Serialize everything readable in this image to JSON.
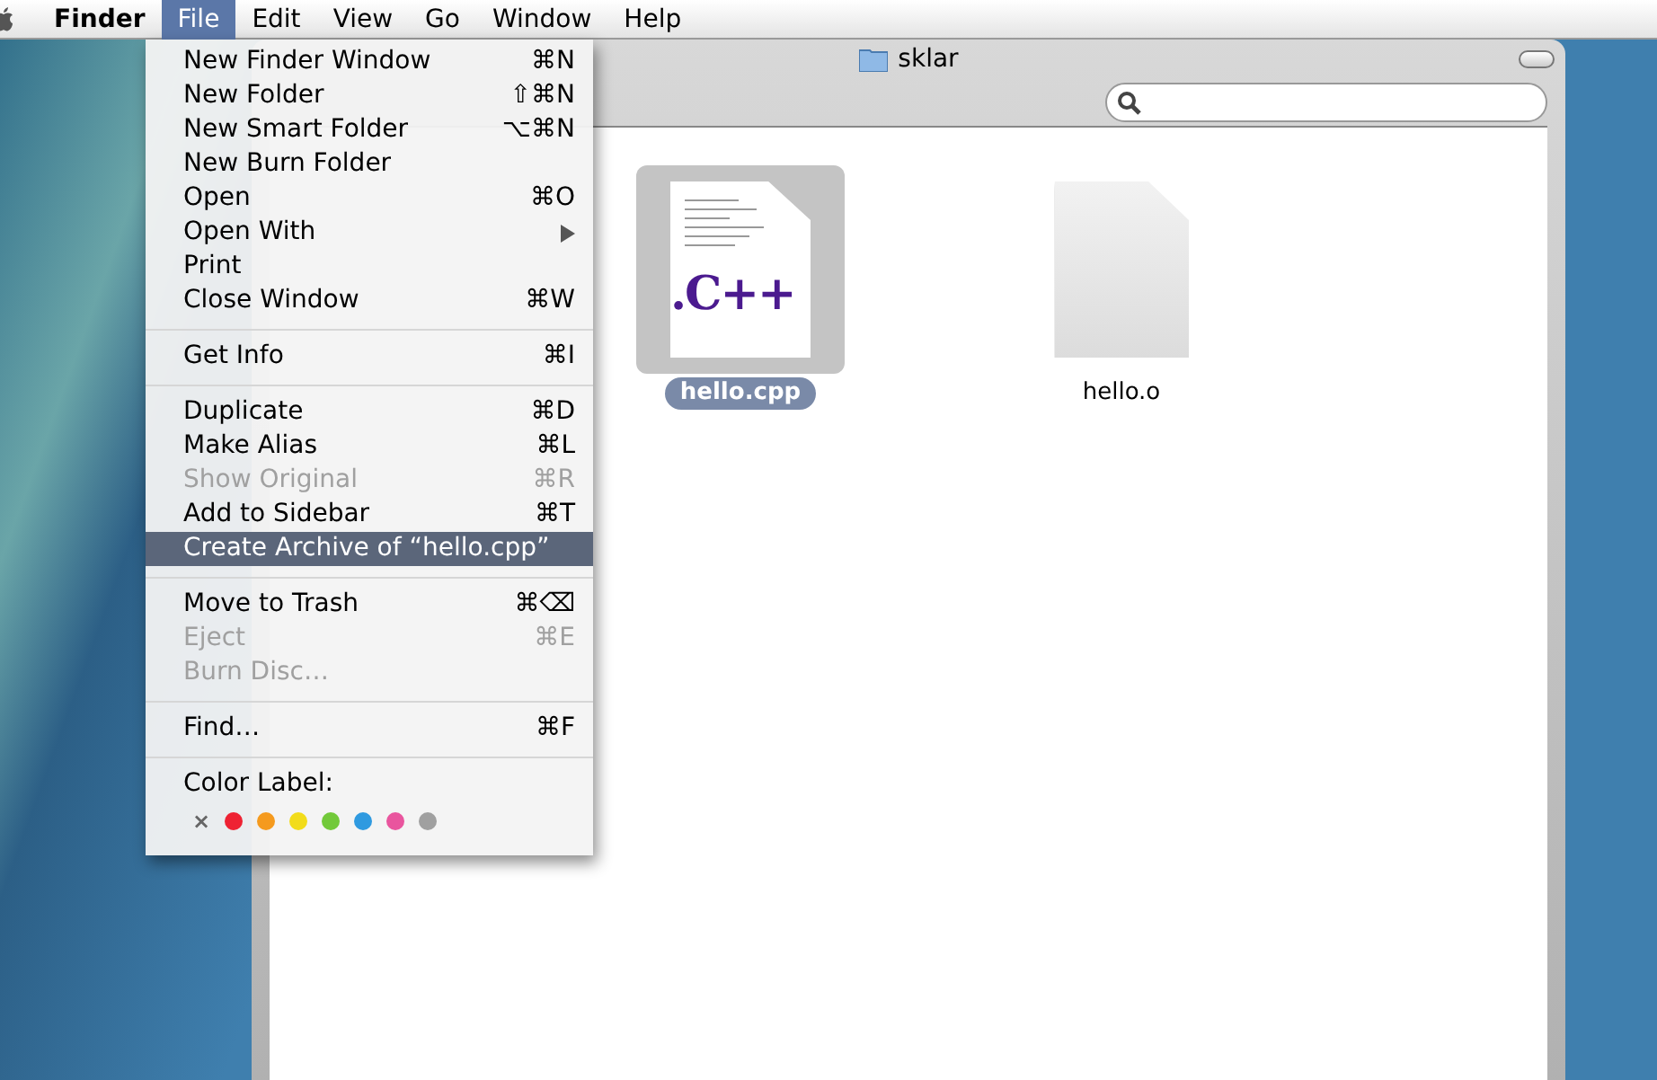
{
  "menu_bar": {
    "items": [
      {
        "label": "Finder",
        "selected": false,
        "bold": true
      },
      {
        "label": "File",
        "selected": true,
        "bold": false
      },
      {
        "label": "Edit",
        "selected": false,
        "bold": false
      },
      {
        "label": "View",
        "selected": false,
        "bold": false
      },
      {
        "label": "Go",
        "selected": false,
        "bold": false
      },
      {
        "label": "Window",
        "selected": false,
        "bold": false
      },
      {
        "label": "Help",
        "selected": false,
        "bold": false
      }
    ]
  },
  "window": {
    "title": "sklar"
  },
  "files": [
    {
      "name": "hello.cpp",
      "selected": true,
      "kind": "cpp",
      "icon_text": ".C++"
    },
    {
      "name": "hello.o",
      "selected": false,
      "kind": "blank"
    }
  ],
  "file_menu": {
    "groups": [
      [
        {
          "label": "New Finder Window",
          "shortcut": "⌘N",
          "disabled": false,
          "selected": false,
          "submenu": false
        },
        {
          "label": "New Folder",
          "shortcut": "⇧⌘N",
          "disabled": false,
          "selected": false,
          "submenu": false
        },
        {
          "label": "New Smart Folder",
          "shortcut": "⌥⌘N",
          "disabled": false,
          "selected": false,
          "submenu": false
        },
        {
          "label": "New Burn Folder",
          "disabled": false,
          "selected": false,
          "submenu": false
        },
        {
          "label": "Open",
          "shortcut": "⌘O",
          "disabled": false,
          "selected": false,
          "submenu": false
        },
        {
          "label": "Open With",
          "disabled": false,
          "selected": false,
          "submenu": true
        },
        {
          "label": "Print",
          "disabled": false,
          "selected": false,
          "submenu": false
        },
        {
          "label": "Close Window",
          "shortcut": "⌘W",
          "disabled": false,
          "selected": false,
          "submenu": false
        }
      ],
      [
        {
          "label": "Get Info",
          "shortcut": "⌘I",
          "disabled": false,
          "selected": false,
          "submenu": false
        }
      ],
      [
        {
          "label": "Duplicate",
          "shortcut": "⌘D",
          "disabled": false,
          "selected": false,
          "submenu": false
        },
        {
          "label": "Make Alias",
          "shortcut": "⌘L",
          "disabled": false,
          "selected": false,
          "submenu": false
        },
        {
          "label": "Show Original",
          "shortcut": "⌘R",
          "disabled": true,
          "selected": false,
          "submenu": false
        },
        {
          "label": "Add to Sidebar",
          "shortcut": "⌘T",
          "disabled": false,
          "selected": false,
          "submenu": false
        },
        {
          "label": "Create Archive of “hello.cpp”",
          "disabled": false,
          "selected": true,
          "submenu": false
        }
      ],
      [
        {
          "label": "Move to Trash",
          "shortcut": "⌘⌫",
          "disabled": false,
          "selected": false,
          "submenu": false
        },
        {
          "label": "Eject",
          "shortcut": "⌘E",
          "disabled": true,
          "selected": false,
          "submenu": false
        },
        {
          "label": "Burn Disc…",
          "disabled": true,
          "selected": false,
          "submenu": false
        }
      ],
      [
        {
          "label": "Find…",
          "shortcut": "⌘F",
          "disabled": false,
          "selected": false,
          "submenu": false
        }
      ]
    ],
    "color_label": {
      "label": "Color Label:",
      "swatches": [
        {
          "kind": "none",
          "text": "×"
        },
        {
          "kind": "color",
          "color": "#ee2233"
        },
        {
          "kind": "color",
          "color": "#f59a1e"
        },
        {
          "kind": "color",
          "color": "#f2dc1a"
        },
        {
          "kind": "color",
          "color": "#72c93a"
        },
        {
          "kind": "color",
          "color": "#2f9ae0"
        },
        {
          "kind": "color",
          "color": "#e9559e"
        },
        {
          "kind": "color",
          "color": "#a0a0a0"
        }
      ]
    }
  }
}
